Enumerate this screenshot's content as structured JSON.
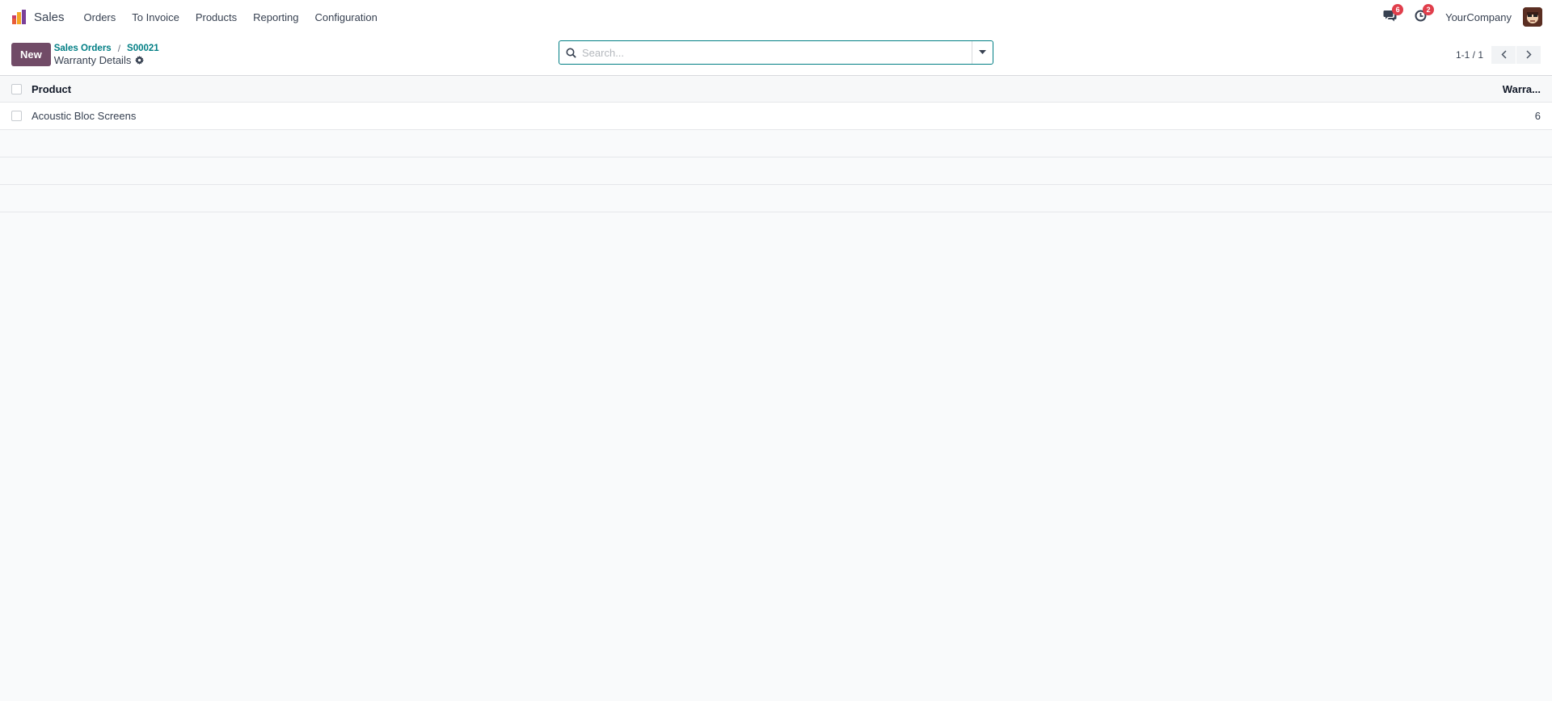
{
  "navbar": {
    "app_name": "Sales",
    "menu": [
      {
        "label": "Orders"
      },
      {
        "label": "To Invoice"
      },
      {
        "label": "Products"
      },
      {
        "label": "Reporting"
      },
      {
        "label": "Configuration"
      }
    ],
    "messages_badge": "6",
    "activities_badge": "2",
    "company": "YourCompany"
  },
  "control_panel": {
    "new_label": "New",
    "breadcrumb": [
      "Sales Orders",
      "S00021"
    ],
    "title": "Warranty Details",
    "search_placeholder": "Search...",
    "pager_value": "1-1 / 1"
  },
  "list": {
    "columns": {
      "product": "Product",
      "warranty": "Warra..."
    },
    "rows": [
      {
        "product": "Acoustic Bloc Screens",
        "warranty": "6"
      }
    ]
  },
  "colors": {
    "brand": "#714b67",
    "accent": "#017e84",
    "badge": "#e03e4b"
  }
}
